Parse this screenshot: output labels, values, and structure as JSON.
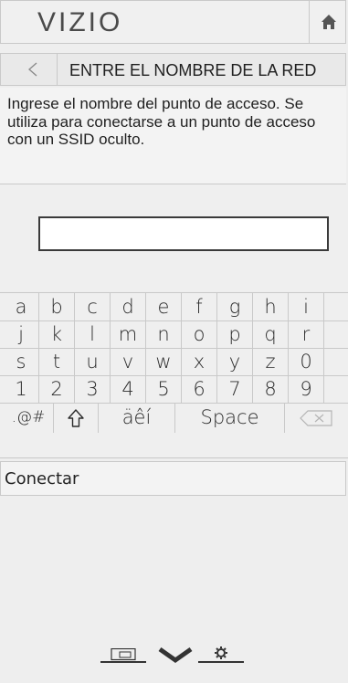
{
  "header": {
    "logo": "VIZIO"
  },
  "titlebar": {
    "title": "ENTRE EL NOMBRE DE LA RED"
  },
  "description": "Ingrese el nombre del punto de acceso. Se utiliza para conectarse a un punto de acceso con un SSID oculto.",
  "ssid_input": {
    "value": ""
  },
  "keyboard": {
    "rows": [
      [
        "a",
        "b",
        "c",
        "d",
        "e",
        "f",
        "g",
        "h",
        "i"
      ],
      [
        "j",
        "k",
        "l",
        "m",
        "n",
        "o",
        "p",
        "q",
        "r"
      ],
      [
        "s",
        "t",
        "u",
        "v",
        "w",
        "x",
        "y",
        "z",
        "0"
      ],
      [
        "1",
        "2",
        "3",
        "4",
        "5",
        "6",
        "7",
        "8",
        "9"
      ]
    ],
    "symbols_label": ".@#",
    "accents_label": "äêí",
    "space_label": "Space"
  },
  "connect": {
    "label": "Conectar"
  },
  "icons": {
    "home": "home-icon",
    "back": "back-arrow-icon",
    "shift": "shift-icon",
    "backspace": "backspace-icon",
    "input": "input-icon",
    "menu_down": "chevron-down-icon",
    "settings": "gear-icon"
  }
}
